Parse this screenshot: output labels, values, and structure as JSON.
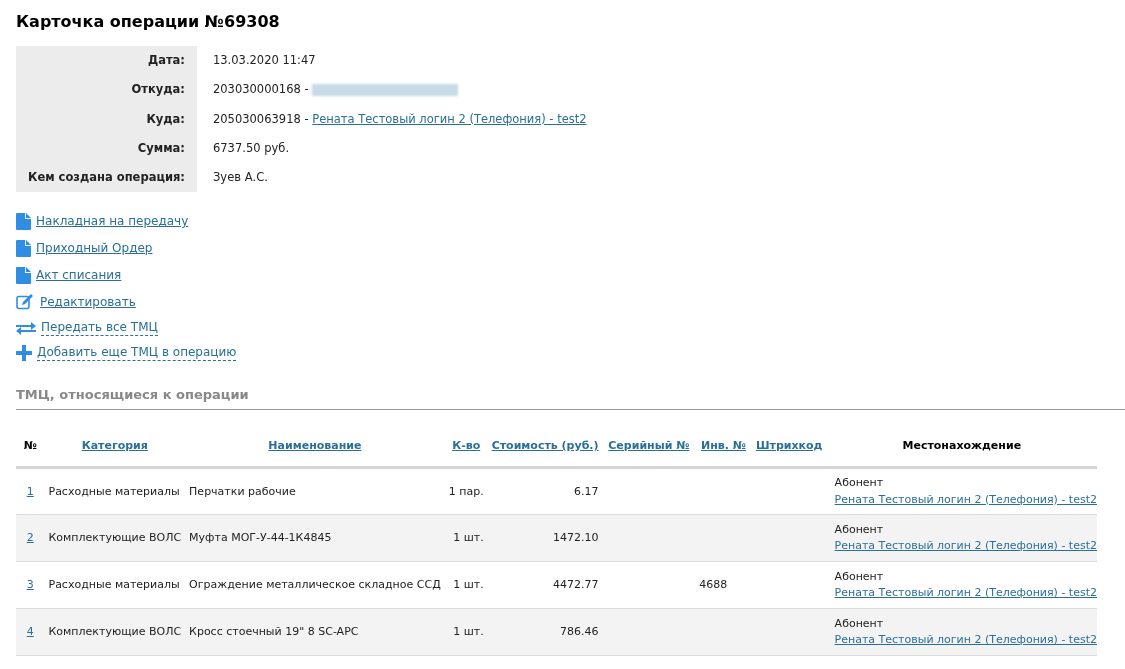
{
  "title": "Карточка операции №69308",
  "details": [
    {
      "label": "Дата:",
      "value": "13.03.2020 11:47"
    },
    {
      "label": "Откуда:",
      "value": "203030000168 - ",
      "redacted_link": true
    },
    {
      "label": "Куда:",
      "value": "205030063918 - ",
      "link": "Рената Тестовый логин 2 (Телефония) - test2"
    },
    {
      "label": "Сумма:",
      "value": "6737.50 руб."
    },
    {
      "label": "Кем создана операция:",
      "value": "Зуев А.С."
    }
  ],
  "actions": [
    {
      "kind": "document",
      "label": "Накладная на передачу"
    },
    {
      "kind": "document",
      "label": "Приходный Ордер"
    },
    {
      "kind": "document",
      "label": "Акт списания"
    },
    {
      "kind": "edit",
      "label": "Редактировать"
    },
    {
      "kind": "transfer",
      "label": "Передать все ТМЦ"
    },
    {
      "kind": "add",
      "label": "Добавить еще ТМЦ в операцию"
    }
  ],
  "section_title": "ТМЦ, относящиеся к операции",
  "table": {
    "columns": [
      {
        "label": "№",
        "sortable": false
      },
      {
        "label": "Категория",
        "sortable": true
      },
      {
        "label": "Наименование",
        "sortable": true
      },
      {
        "label": "К-во",
        "sortable": true
      },
      {
        "label": "Стоимость (руб.)",
        "sortable": true
      },
      {
        "label": "Серийный №",
        "sortable": true
      },
      {
        "label": "Инв. №",
        "sortable": true
      },
      {
        "label": "Штрихкод",
        "sortable": true
      },
      {
        "label": "Местонахождение",
        "sortable": false
      }
    ],
    "rows": [
      {
        "number": "1",
        "category": "Расходные материалы",
        "name": "Перчатки рабочие",
        "quantity": "1 пар.",
        "cost": "6.17",
        "location_type": "Абонент",
        "location": "Рената Тестовый логин 2 (Телефония) - test2"
      },
      {
        "number": "2",
        "category": "Комплектующие ВОЛС",
        "name": "Муфта МОГ-У-44-1К4845",
        "quantity": "1 шт.",
        "cost": "1472.10",
        "location_type": "Абонент",
        "location": "Рената Тестовый логин 2 (Телефония) - test2"
      },
      {
        "number": "3",
        "category": "Расходные материалы",
        "name": "Ограждение металлическое складное ССД",
        "quantity": "1 шт.",
        "cost": "4472.77",
        "inventory": "4688",
        "location_type": "Абонент",
        "location": "Рената Тестовый логин 2 (Телефония) - test2"
      },
      {
        "number": "4",
        "category": "Комплектующие ВОЛС",
        "name": "Кросс стоечный 19\" 8 SC-APC",
        "quantity": "1 шт.",
        "cost": "786.46",
        "location_type": "Абонент",
        "location": "Рената Тестовый логин 2 (Телефония) - test2"
      }
    ]
  }
}
